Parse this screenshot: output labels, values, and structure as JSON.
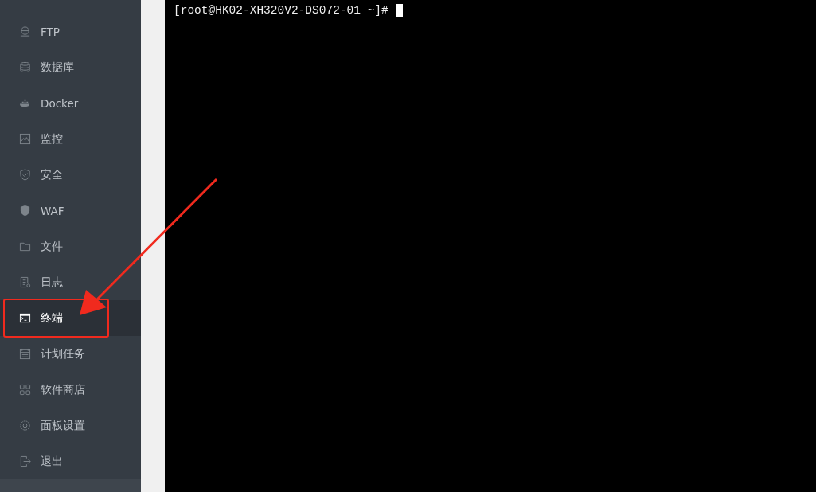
{
  "sidebar": {
    "items": [
      {
        "label": "FTP",
        "selected": false
      },
      {
        "label": "数据库",
        "selected": false
      },
      {
        "label": "Docker",
        "selected": false
      },
      {
        "label": "监控",
        "selected": false
      },
      {
        "label": "安全",
        "selected": false
      },
      {
        "label": "WAF",
        "selected": false
      },
      {
        "label": "文件",
        "selected": false
      },
      {
        "label": "日志",
        "selected": false
      },
      {
        "label": "终端",
        "selected": true
      },
      {
        "label": "计划任务",
        "selected": false
      },
      {
        "label": "软件商店",
        "selected": false
      },
      {
        "label": "面板设置",
        "selected": false
      },
      {
        "label": "退出",
        "selected": false
      }
    ]
  },
  "terminal": {
    "prompt": "[root@HK02-XH320V2-DS072-01 ~]#"
  }
}
